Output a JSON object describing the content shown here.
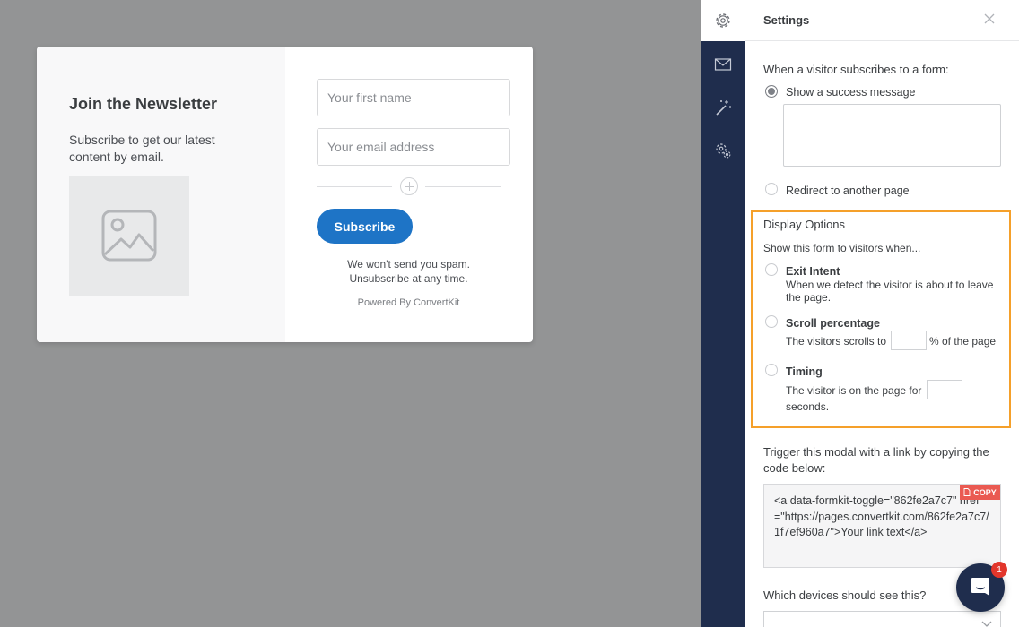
{
  "form_preview": {
    "title": "Join the Newsletter",
    "description": "Subscribe to get our latest content by email.",
    "image_icon": "image-placeholder-icon",
    "first_name_placeholder": "Your first name",
    "email_placeholder": "Your email address",
    "add_field_icon": "plus-circle-icon",
    "subscribe_label": "Subscribe",
    "spam_note": "We won't send you spam. Unsubscribe at any time.",
    "powered_by": "Powered By ConvertKit",
    "button_color": "#1e74c6"
  },
  "sidebar_nav": {
    "items": [
      {
        "icon": "gear-icon",
        "active": true
      },
      {
        "icon": "envelope-icon",
        "active": false
      },
      {
        "icon": "magic-wand-icon",
        "active": false
      },
      {
        "icon": "gears-icon",
        "active": false
      }
    ],
    "background": "#1f2d4d"
  },
  "settings": {
    "title": "Settings",
    "close_icon": "close-icon",
    "subscribe_heading": "When a visitor subscribes to a form:",
    "success_option": "Show a success message",
    "redirect_option": "Redirect to another page",
    "success_selected": true,
    "display_options": {
      "heading": "Display Options",
      "subheading": "Show this form to visitors when...",
      "highlight_color": "#f5a02a",
      "exit_intent": {
        "label": "Exit Intent",
        "desc_line1": "When we detect the visitor is about to leave",
        "desc_line2": "the page."
      },
      "scroll": {
        "label": "Scroll percentage",
        "prefix": "The visitors scrolls to",
        "suffix": "% of the page"
      },
      "timing": {
        "label": "Timing",
        "prefix": "The visitor is on the page for",
        "suffix": "seconds."
      }
    },
    "trigger": {
      "heading_line1": "Trigger this modal with a link by copying the",
      "heading_line2": "code below:",
      "code": "<a data-formkit-toggle=\"862fe2a7c7\" href=\"https://pages.convertkit.com/862fe2a7c7/1f7ef960a7\">Your link text</a>",
      "copy_label": "COPY",
      "copy_color": "#ea5a52"
    },
    "devices_heading": "Which devices should see this?"
  },
  "chat": {
    "icon": "chat-icon",
    "badge_count": "1"
  }
}
